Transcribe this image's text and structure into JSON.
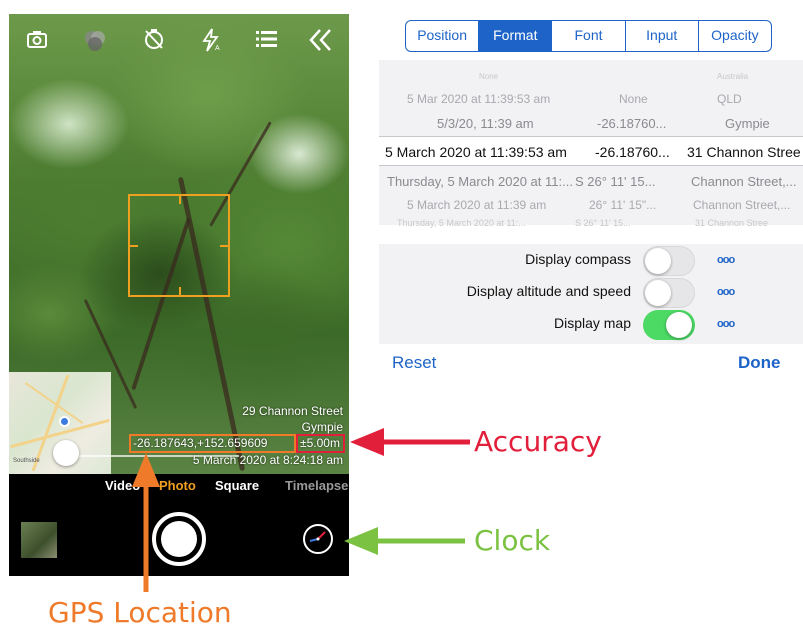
{
  "camera": {
    "toolbar_icons": [
      "camera-flip-icon",
      "filters-icon",
      "timer-off-icon",
      "flash-auto-icon",
      "menu-list-icon",
      "collapse-chevrons-icon"
    ],
    "overlay": {
      "address": "29 Channon Street",
      "town": "Gympie",
      "gps": "-26.187643,+152.659609",
      "accuracy": "±5.00m",
      "datetime": "5 March 2020 at 8:24:18 am"
    },
    "map_label": "Southside",
    "modes": [
      "Video",
      "Photo",
      "Square",
      "Timelapse"
    ],
    "active_mode": "Photo",
    "accent_color": "#f0a020"
  },
  "annotations": {
    "accuracy": "Accuracy",
    "clock": "Clock",
    "gps": "GPS Location",
    "accuracy_color": "#e21f3b",
    "clock_color": "#7cc242",
    "gps_color": "#ef7a2a"
  },
  "settings": {
    "tabs": [
      "Position",
      "Format",
      "Font",
      "Input",
      "Opacity"
    ],
    "active_tab": "Format",
    "picker_rows": [
      {
        "date": "None",
        "coord": "",
        "place": "Australia"
      },
      {
        "date": "5 Mar 2020 at 11:39:53 am",
        "coord": "None",
        "place": "QLD"
      },
      {
        "date": "5/3/20, 11:39 am",
        "coord": "-26.18760...",
        "place": "Gympie"
      },
      {
        "date": "5 March 2020 at 11:39:53 am",
        "coord": "-26.18760...",
        "place": "31 Channon Stree"
      },
      {
        "date": "Thursday, 5 March 2020 at 11:...",
        "coord": "S 26° 11' 15...",
        "place": "Channon Street,..."
      },
      {
        "date": "5 March 2020 at 11:39 am",
        "coord": "26° 11' 15\"...",
        "place": "Channon Street,..."
      },
      {
        "date": "Thursday, 5 March 2020 at 11:...",
        "coord": "S 26° 11' 15...",
        "place": "31 Channon Stree"
      }
    ],
    "toggles": [
      {
        "label": "Display compass",
        "on": false,
        "dots": "ooo"
      },
      {
        "label": "Display altitude and speed",
        "on": false,
        "dots": "ooo"
      },
      {
        "label": "Display map",
        "on": true,
        "dots": "ooo"
      }
    ],
    "reset": "Reset",
    "done": "Done",
    "accent_color": "#1e64c8"
  }
}
